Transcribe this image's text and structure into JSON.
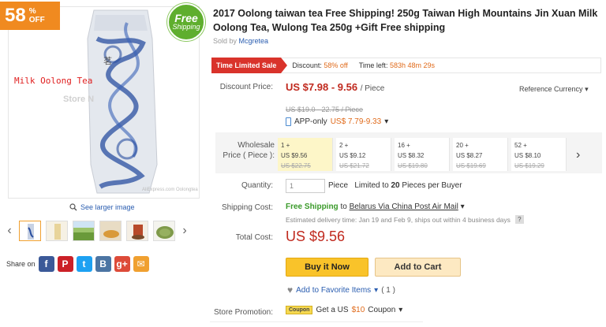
{
  "badges": {
    "discount_num": "58",
    "discount_pct": "%",
    "discount_off": "OFF",
    "free_l1": "Free",
    "free_l2": "Shipping"
  },
  "image": {
    "label": "Milk Oolong Tea",
    "watermark_store": "Store N",
    "watermark_bottom": "AliExpress.com  Oolongtea"
  },
  "gallery": {
    "see_larger": "See larger image",
    "prev": "‹",
    "next": "›"
  },
  "share": {
    "label": "Share on",
    "icons": [
      "facebook-icon",
      "pinterest-icon",
      "twitter-icon",
      "vk-icon",
      "googleplus-icon",
      "email-icon"
    ]
  },
  "product": {
    "title": "2017 Oolong taiwan tea Free Shipping! 250g Taiwan High Mountains Jin Xuan Milk Oolong Tea, Wulong Tea 250g +Gift Free shipping",
    "sold_by_label": "Sold by",
    "seller": "Mcgretea"
  },
  "sale": {
    "label": "Time Limited Sale",
    "discount_label": "Discount:",
    "discount_value": "58% off",
    "time_label": "Time left:",
    "time_value": "583h 48m 29s"
  },
  "price": {
    "label": "Discount Price:",
    "range": "US $7.98 - 9.56",
    "unit": "/ Piece",
    "reference_currency": "Reference Currency",
    "original": "US $19.0 - 22.75 / Piece",
    "app_label": "APP-only",
    "app_price": "US$ 7.79-9.33"
  },
  "wholesale": {
    "label_l1": "Wholesale",
    "label_l2": "Price ( Piece ):",
    "tiers": [
      {
        "qty": "1 +",
        "price": "US $9.56",
        "old": "US $22.75"
      },
      {
        "qty": "2 +",
        "price": "US $9.12",
        "old": "US $21.72"
      },
      {
        "qty": "16 +",
        "price": "US $8.32",
        "old": "US $19.80"
      },
      {
        "qty": "20 +",
        "price": "US $8.27",
        "old": "US $19.69"
      },
      {
        "qty": "52 +",
        "price": "US $8.10",
        "old": "US $19.29"
      }
    ],
    "next": "›"
  },
  "quantity": {
    "label": "Quantity:",
    "value": "1",
    "unit": "Piece",
    "limit_pre": "Limited to ",
    "limit_num": "20",
    "limit_post": " Pieces per Buyer"
  },
  "shipping": {
    "label": "Shipping Cost:",
    "free": "Free Shipping",
    "to": "to",
    "destination": "Belarus Via China Post Air Mail",
    "estimate": "Estimated delivery time: Jan 19 and Feb 9, ships out within 4 business days",
    "help": "?"
  },
  "total": {
    "label": "Total Cost:",
    "value": "US $9.56"
  },
  "actions": {
    "buy": "Buy it Now",
    "cart": "Add to Cart",
    "favorite": "Add to Favorite Items",
    "fav_count": "( 1 )"
  },
  "promotion": {
    "label": "Store Promotion:",
    "tag": "Coupon",
    "text_pre": "Get a US ",
    "amount": "$10",
    "text_post": " Coupon"
  },
  "colors": {
    "accent_red": "#c0291e",
    "orange": "#f08a20",
    "green": "#5fae2e",
    "buy_yellow": "#f9c32a"
  }
}
